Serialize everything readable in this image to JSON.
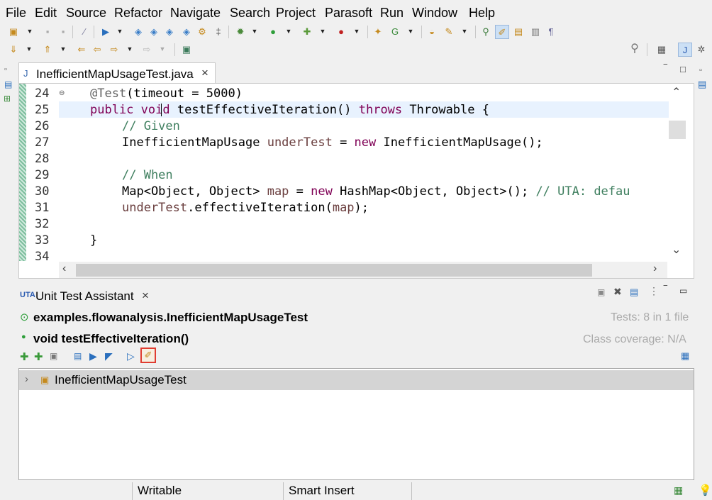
{
  "menu": [
    "File",
    "Edit",
    "Source",
    "Refactor",
    "Navigate",
    "Search",
    "Project",
    "Parasoft",
    "Run",
    "Window",
    "Help"
  ],
  "editor": {
    "tab_title": "InefficientMapUsageTest.java",
    "tab_close": "×",
    "line_numbers": [
      "24",
      "25",
      "26",
      "27",
      "28",
      "29",
      "30",
      "31",
      "32",
      "33",
      "34"
    ],
    "fold_marker": "⊖",
    "code": {
      "l24_ann": "@Test",
      "l24_rest": "(timeout = 5000)",
      "l25_kw1": "public",
      "l25_kw2": "void",
      "l25_name": " testEffectiveIteration() ",
      "l25_kw3": "throws",
      "l25_rest": " Throwable {",
      "l26": "// Given",
      "l27_type": "InefficientMapUsage ",
      "l27_var": "underTest",
      "l27_eq": " = ",
      "l27_kw": "new",
      "l27_rest": " InefficientMapUsage();",
      "l29": "// When",
      "l30_type": "Map<Object, Object> ",
      "l30_var": "map",
      "l30_eq": " = ",
      "l30_kw": "new",
      "l30_rest": " HashMap<Object, Object>(); ",
      "l30_comment": "// UTA: defau",
      "l31_var": "underTest",
      "l31_mid": ".effectiveIteration(",
      "l31_arg": "map",
      "l31_end": ");",
      "l33": "}"
    }
  },
  "uta": {
    "tab_title": "Unit Test Assistant",
    "tab_close": "×",
    "class_name": "examples.flowanalysis.InefficientMapUsageTest",
    "method_name": "void testEffectiveIteration()",
    "tests_info": "Tests: 8 in 1 file",
    "coverage_info": "Class coverage: N/A",
    "tree_item": "InefficientMapUsageTest",
    "highlight_color": "#e03c31"
  },
  "status": {
    "writable": "Writable",
    "insert_mode": "Smart Insert"
  }
}
